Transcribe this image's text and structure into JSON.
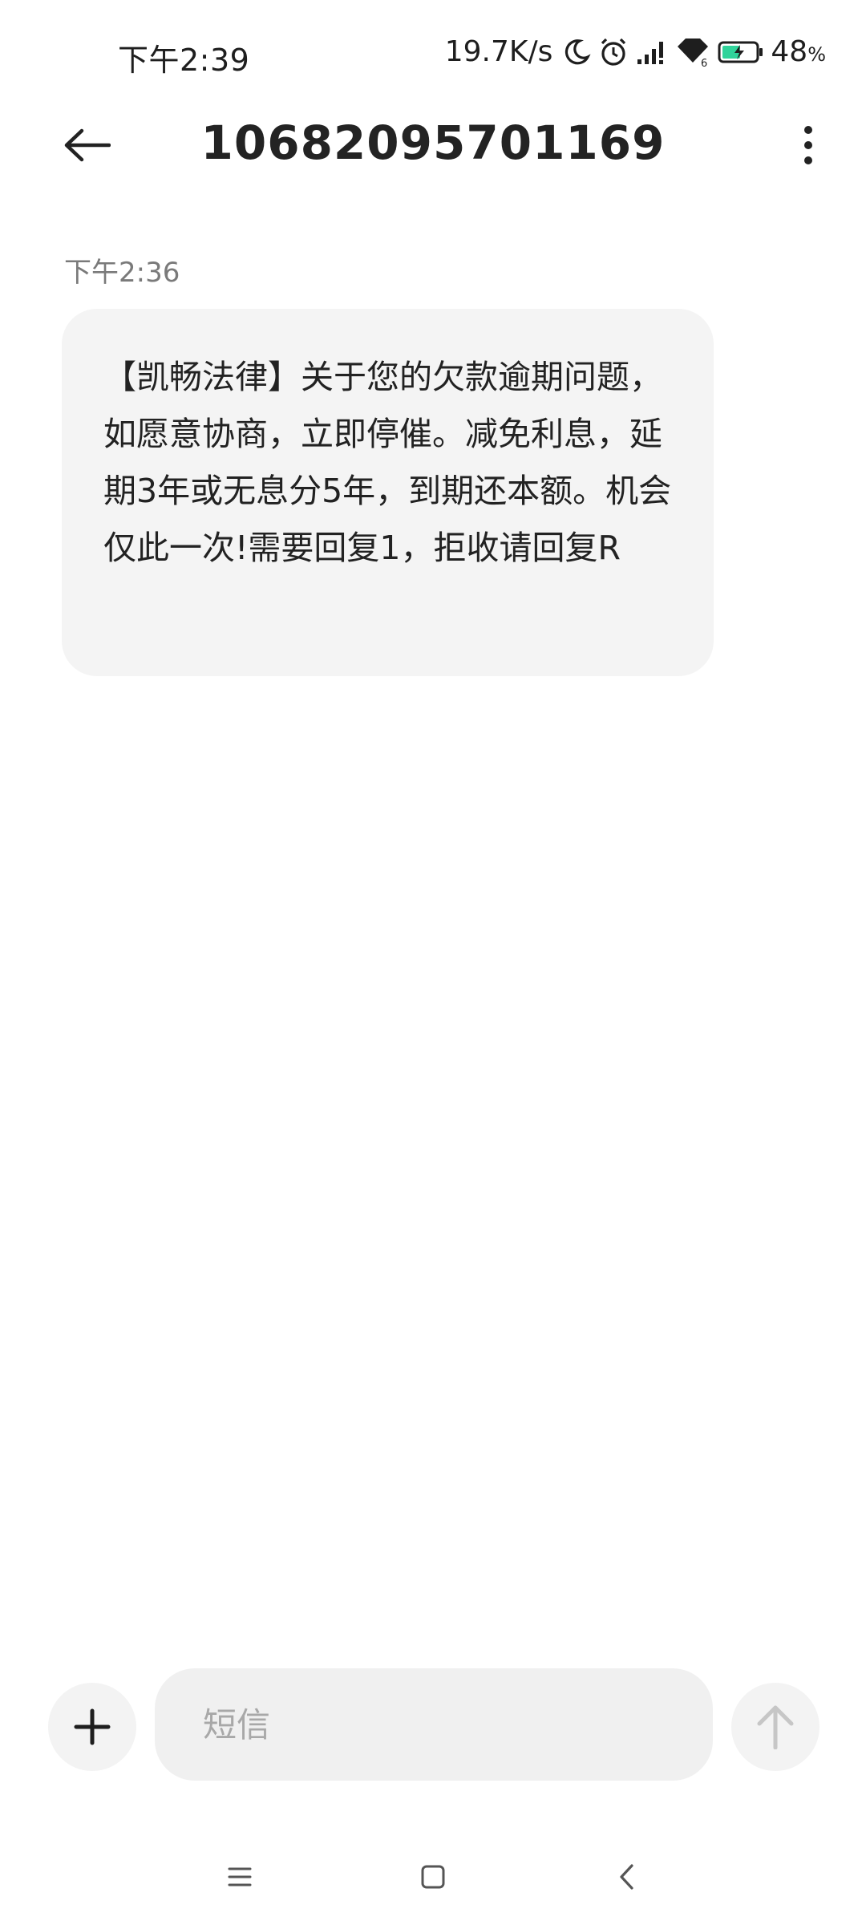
{
  "status_bar": {
    "time": "下午2:39",
    "net_speed": "19.7K/s",
    "battery_percent": "48",
    "battery_unit": "%",
    "icons": [
      "moon-icon",
      "alarm-icon",
      "signal-icon",
      "wifi-icon",
      "battery-charging-icon"
    ]
  },
  "header": {
    "title": "10682095701169",
    "back_icon": "arrow-left-icon",
    "more_icon": "more-vertical-icon"
  },
  "messages": [
    {
      "time": "下午2:36",
      "text": "【凯畅法律】关于您的欠款逾期问题，如愿意协商，立即停催。减免利息，延期3年或无息分5年，到期还本额。机会仅此一次!需要回复1，拒收请回复R"
    }
  ],
  "composer": {
    "placeholder": "短信",
    "value": "",
    "add_icon": "plus-icon",
    "send_icon": "arrow-up-icon"
  },
  "navigation": {
    "icons": [
      "menu-icon",
      "home-square-icon",
      "back-chevron-icon"
    ]
  },
  "colors": {
    "bubble_bg": "#f4f4f4",
    "input_bg": "#f0f0f0",
    "text": "#222222",
    "muted": "#7a7a7a"
  }
}
